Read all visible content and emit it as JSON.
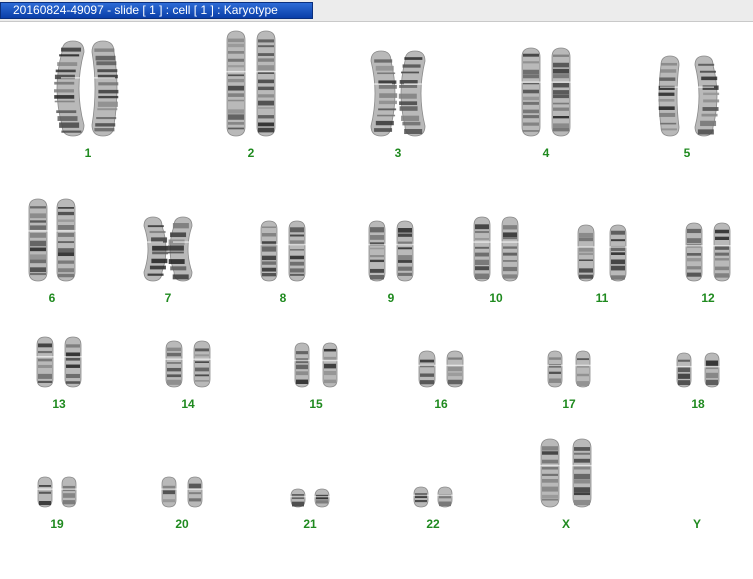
{
  "window": {
    "title": "20160824-49097 - slide [ 1 ] : cell [ 1 ] : Karyotype"
  },
  "karyotype": {
    "chromosomes": [
      {
        "label": "1",
        "count": 2
      },
      {
        "label": "2",
        "count": 2
      },
      {
        "label": "3",
        "count": 2
      },
      {
        "label": "4",
        "count": 2
      },
      {
        "label": "5",
        "count": 2
      },
      {
        "label": "6",
        "count": 2
      },
      {
        "label": "7",
        "count": 2
      },
      {
        "label": "8",
        "count": 2
      },
      {
        "label": "9",
        "count": 2
      },
      {
        "label": "10",
        "count": 2
      },
      {
        "label": "11",
        "count": 2
      },
      {
        "label": "12",
        "count": 2
      },
      {
        "label": "13",
        "count": 2
      },
      {
        "label": "14",
        "count": 2
      },
      {
        "label": "15",
        "count": 2
      },
      {
        "label": "16",
        "count": 2
      },
      {
        "label": "17",
        "count": 2
      },
      {
        "label": "18",
        "count": 2
      },
      {
        "label": "19",
        "count": 2
      },
      {
        "label": "20",
        "count": 2
      },
      {
        "label": "21",
        "count": 2
      },
      {
        "label": "22",
        "count": 2
      },
      {
        "label": "X",
        "count": 2
      },
      {
        "label": "Y",
        "count": 0
      }
    ],
    "label_color": "#1f8a1f"
  }
}
